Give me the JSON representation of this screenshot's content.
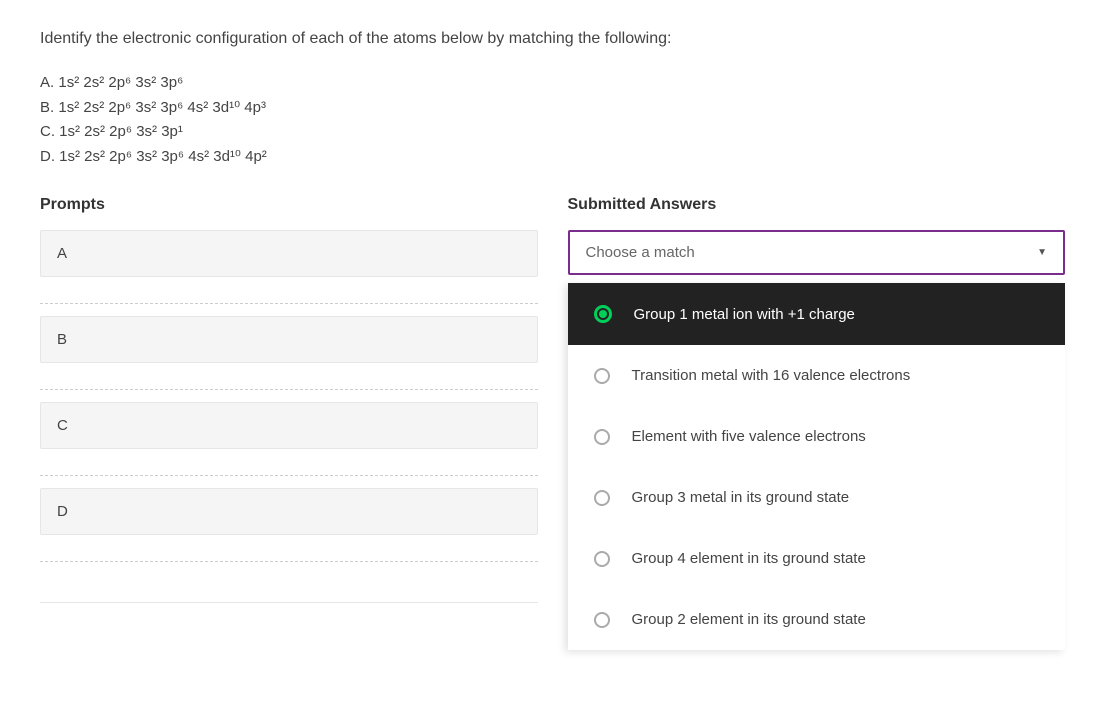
{
  "question": "Identify the electronic configuration of each of the atoms below by matching the following:",
  "options": {
    "a": {
      "label": "A.",
      "config": "1s² 2s² 2p⁶ 3s² 3p⁶"
    },
    "b": {
      "label": "B.",
      "config": "1s² 2s² 2p⁶ 3s² 3p⁶ 4s² 3d¹⁰ 4p³"
    },
    "c": {
      "label": "C.",
      "config": "1s² 2s² 2p⁶ 3s² 3p¹"
    },
    "d": {
      "label": "D.",
      "config": "1s² 2s² 2p⁶ 3s² 3p⁶ 4s² 3d¹⁰ 4p²"
    }
  },
  "headers": {
    "prompts": "Prompts",
    "answers": "Submitted Answers"
  },
  "prompts": {
    "a": "A",
    "b": "B",
    "c": "C",
    "d": "D"
  },
  "select": {
    "placeholder": "Choose a match"
  },
  "dropdown": {
    "opt1": "Group 1 metal ion with +1 charge",
    "opt2": "Transition metal with 16 valence electrons",
    "opt3": "Element with five valence electrons",
    "opt4": "Group 3 metal in its ground state",
    "opt5": "Group 4 element in its ground state",
    "opt6": "Group 2 element in its ground state"
  }
}
